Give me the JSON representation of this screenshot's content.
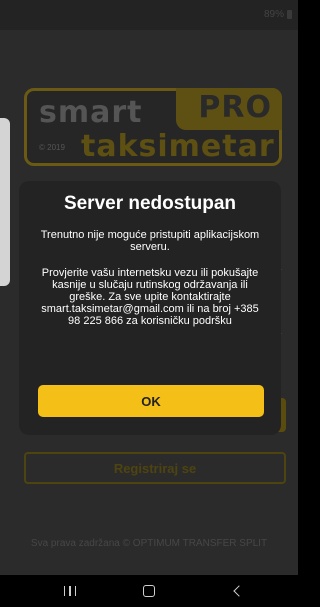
{
  "statusbar": {
    "battery_text": "89%"
  },
  "logo": {
    "smart": "smart",
    "pro": "PRO",
    "taksimetar": "taksimetar",
    "year": "© 2019"
  },
  "background": {
    "register_label": "Registriraj se",
    "footer": "Sva prava zadržana © OPTIMUM TRANSFER SPLIT"
  },
  "dialog": {
    "title": "Server nedostupan",
    "message_1": "Trenutno nije moguće pristupiti aplikacijskom serveru.",
    "message_2": "Provjerite vašu internetsku vezu ili pokušajte kasnije u slučaju rutinskog održavanja ili greške. Za sve upite kontaktirajte smart.taksimetar@gmail.com ili na broj +385 98 225 866 za korisničku podršku",
    "ok_label": "OK"
  },
  "navbar": {
    "recent_icon": "recent-apps-icon",
    "home_icon": "home-icon",
    "back_icon": "back-icon"
  },
  "colors": {
    "accent": "#f4bf16",
    "dialog_bg": "#232323"
  }
}
